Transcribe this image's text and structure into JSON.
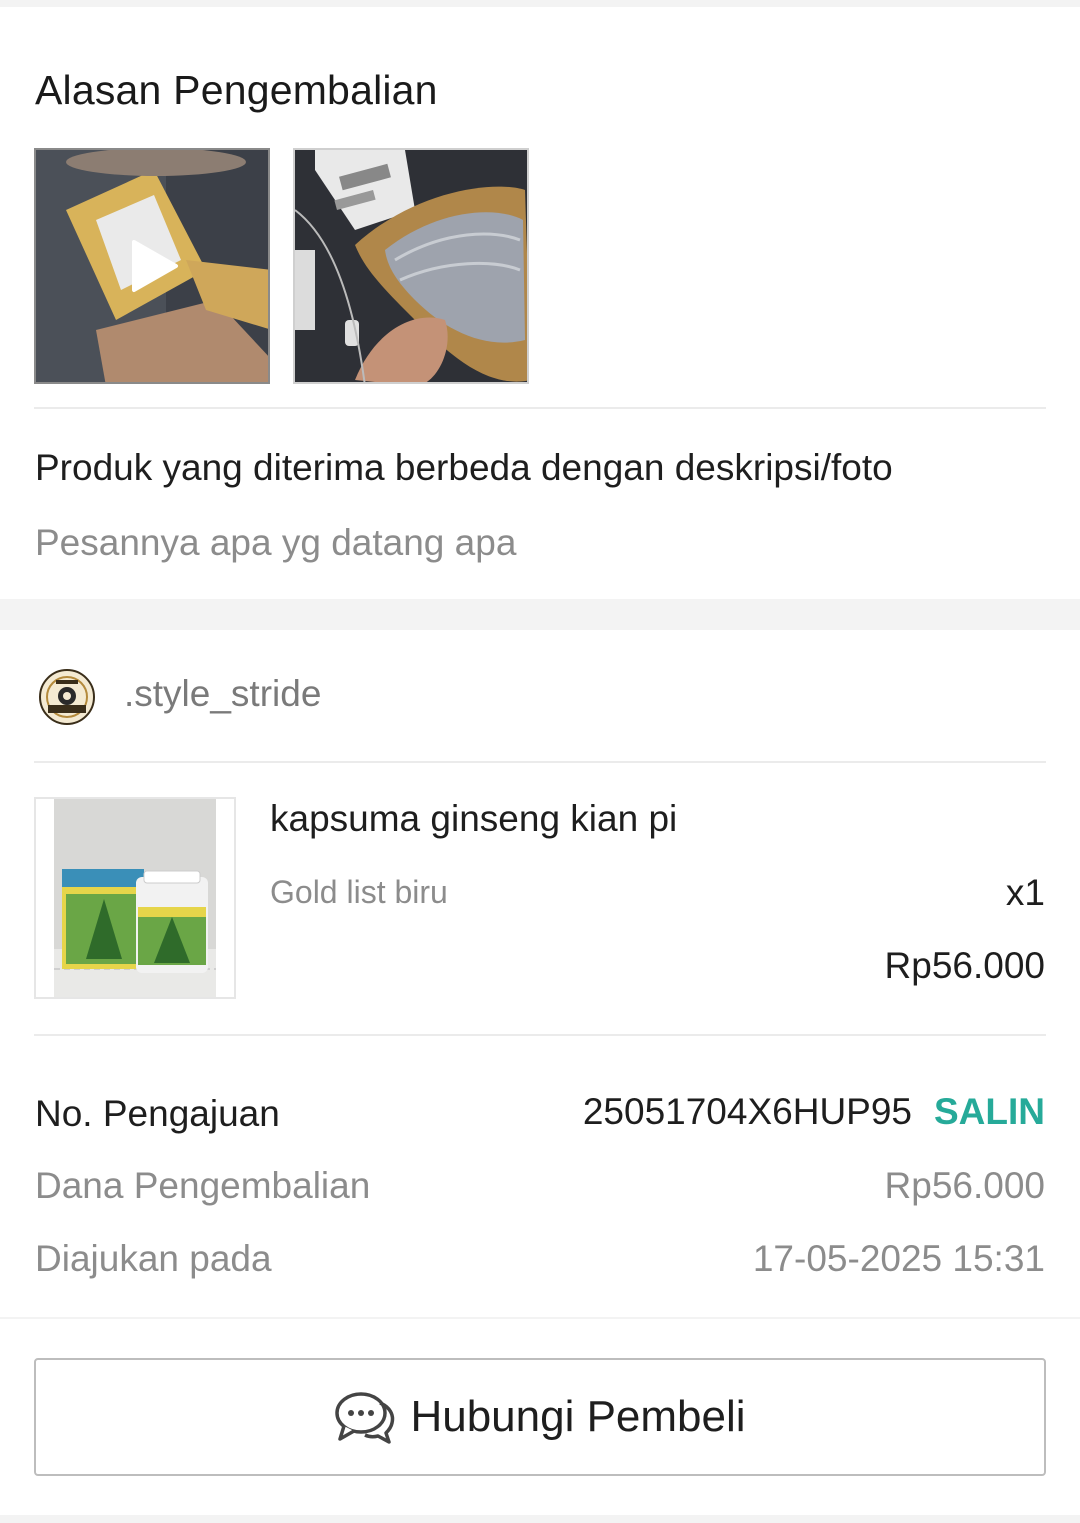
{
  "reason": {
    "title": "Alasan Pengembalian",
    "media": [
      {
        "type": "video",
        "icon": "play-icon"
      },
      {
        "type": "photo"
      }
    ],
    "main_reason": "Produk yang diterima berbeda dengan deskripsi/foto",
    "note": "Pesannya apa yg datang apa"
  },
  "shop": {
    "name": ".style_stride",
    "logo_icon": "shop-logo"
  },
  "product": {
    "name": "kapsuma ginseng kian pi",
    "variant": "Gold list biru",
    "quantity": "x1",
    "price": "Rp56.000"
  },
  "details": {
    "request_label": "No. Pengajuan",
    "request_number": "25051704X6HUP95",
    "copy_label": "SALIN",
    "refund_label": "Dana Pengembalian",
    "refund_amount": "Rp56.000",
    "date_label": "Diajukan pada",
    "date_value": "17-05-2025 15:31"
  },
  "action": {
    "contact_label": "Hubungi Pembeli",
    "icon": "chat-icon"
  },
  "colors": {
    "accent": "#26aa99",
    "muted_text": "#8c8c8c",
    "page_bg": "#f3f3f3"
  }
}
